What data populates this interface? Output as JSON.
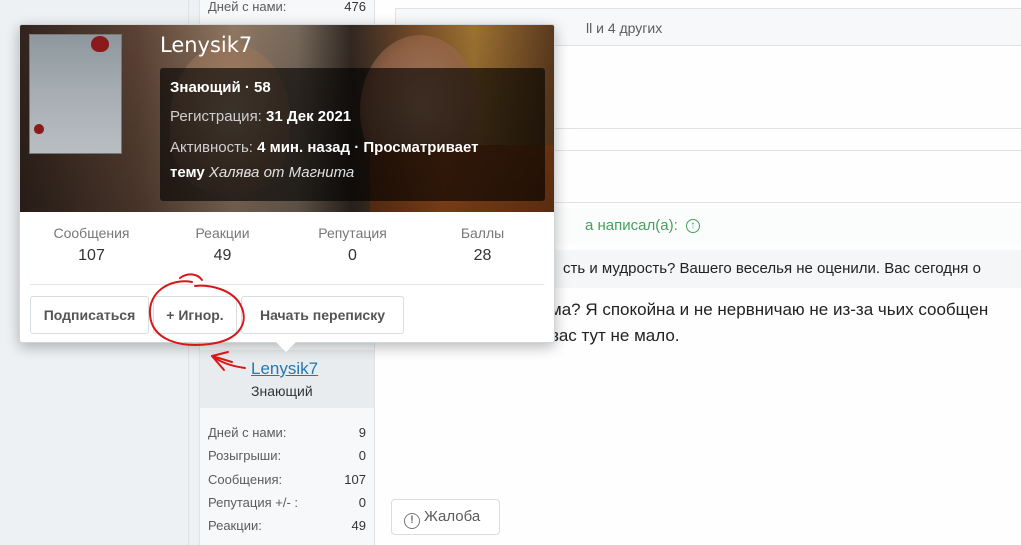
{
  "sidebar_top": {
    "days_label": "Дней с нами:",
    "days_value": "476"
  },
  "reactions": {
    "text": "ll и 4 других"
  },
  "quote": {
    "header": "а написал(а):",
    "body": "сть и мудрость? Вашего веселья не оценили. Вас сегодня о"
  },
  "post": {
    "line1": "ма? Я спокойна и не нервничаю не из-за чьих сообщен",
    "line2": "вас тут не мало."
  },
  "report_button": "Жалоба",
  "author": {
    "name": "Lenysik7",
    "title": "Знающий",
    "stats": [
      {
        "label": "Дней с нами:",
        "value": "9"
      },
      {
        "label": "Розыгрыши:",
        "value": "0"
      },
      {
        "label": "Сообщения:",
        "value": "107"
      },
      {
        "label": "Репутация +/- :",
        "value": "0"
      },
      {
        "label": "Реакции:",
        "value": "49"
      }
    ]
  },
  "popup": {
    "username": "Lenysik7",
    "rank": "Знающий · 58",
    "registration_label": "Регистрация:",
    "registration_value": "31 Дек 2021",
    "activity_label": "Активность:",
    "activity_value": "4 мин. назад · Просматривает",
    "activity_prefix": "тему",
    "activity_topic": "Халява от Магнита",
    "stats": [
      {
        "label": "Сообщения",
        "value": "107"
      },
      {
        "label": "Реакции",
        "value": "49"
      },
      {
        "label": "Репутация",
        "value": "0"
      },
      {
        "label": "Баллы",
        "value": "28"
      }
    ],
    "buttons": {
      "subscribe": "Подписаться",
      "ignore": "+ Игнор.",
      "message": "Начать переписку"
    }
  },
  "colors": {
    "link": "#2577b1",
    "quote_green": "#47a05a",
    "annotation_red": "#d81818"
  }
}
